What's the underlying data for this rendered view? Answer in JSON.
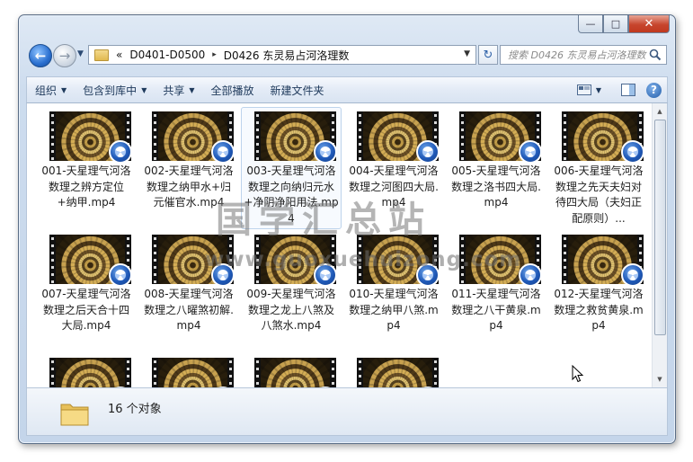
{
  "window": {
    "buttons": {
      "minimize": "—",
      "maximize": "□",
      "close": "✕"
    }
  },
  "nav": {
    "back_glyph": "←",
    "forward_glyph": "→",
    "address": {
      "overflow": "«",
      "segments": [
        "D0401-D0500",
        "D0426 东灵易占河洛理数"
      ],
      "separator": "▸"
    },
    "refresh_glyph": "↻",
    "search_placeholder": "搜索 D0426 东灵易占河洛理数"
  },
  "toolbar": {
    "organize": "组织",
    "include_in_library": "包含到库中",
    "share": "共享",
    "play_all": "全部播放",
    "new_folder": "新建文件夹",
    "help_glyph": "?"
  },
  "files": [
    {
      "name": "001-天星理气河洛数理之辨方定位+纳甲.mp4"
    },
    {
      "name": "002-天星理气河洛数理之纳甲水+归元催官水.mp4"
    },
    {
      "name": "003-天星理气河洛数理之向纳归元水+净阴净阳用法.mp4"
    },
    {
      "name": "004-天星理气河洛数理之河图四大局.mp4"
    },
    {
      "name": "005-天星理气河洛数理之洛书四大局.mp4"
    },
    {
      "name": "006-天星理气河洛数理之先天夫妇对待四大局（夫妇正配原则）..."
    },
    {
      "name": "007-天星理气河洛数理之后天合十四大局.mp4"
    },
    {
      "name": "008-天星理气河洛数理之八曜煞初解.mp4"
    },
    {
      "name": "009-天星理气河洛数理之龙上八煞及八煞水.mp4"
    },
    {
      "name": "010-天星理气河洛数理之纳甲八煞.mp4"
    },
    {
      "name": "011-天星理气河洛数理之八干黄泉.mp4"
    },
    {
      "name": "012-天星理气河洛数理之救贫黄泉.mp4"
    },
    {
      "name": ""
    },
    {
      "name": ""
    },
    {
      "name": ""
    },
    {
      "name": ""
    }
  ],
  "details": {
    "count": "16 个对象"
  },
  "watermark": {
    "text": "国学汇总站",
    "url": "www.guoxuehuizong.com"
  },
  "colors": {
    "accent": "#2a6fcf",
    "close": "#c7452d",
    "toolbar_text": "#1e395b"
  }
}
